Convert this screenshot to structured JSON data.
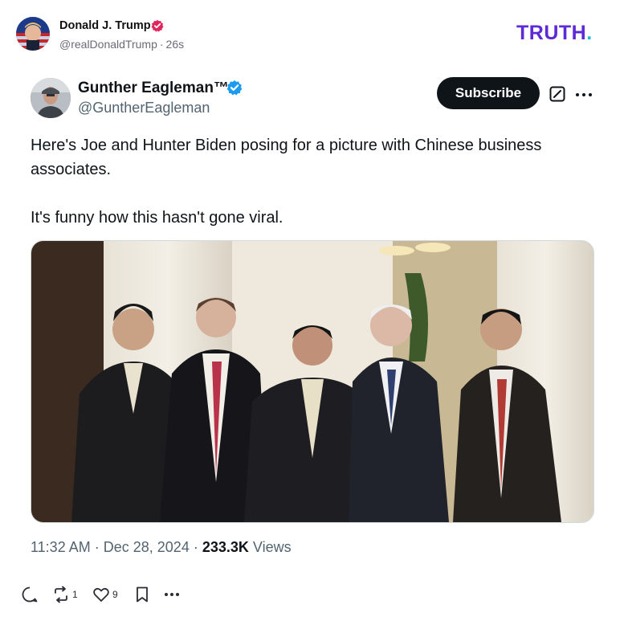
{
  "header": {
    "author_name": "Donald J. Trump",
    "author_handle": "@realDonaldTrump",
    "separator": "·",
    "time_ago": "26s",
    "logo_text": "TRUTH",
    "logo_dot": "."
  },
  "post": {
    "author_name": "Gunther Eagleman™",
    "author_handle": "@GuntherEagleman",
    "subscribe_label": "Subscribe",
    "paragraphs": [
      "Here's Joe and Hunter Biden posing for a picture with Chinese business associates.",
      "It's funny how this hasn't gone viral."
    ],
    "time": "11:32 AM",
    "date": "Dec 28, 2024",
    "views_count": "233.3K",
    "views_label": "Views",
    "sep": "·"
  },
  "actions": {
    "reply_count": "",
    "repost_count": "1",
    "like_count": "9"
  },
  "colors": {
    "truth_purple": "#5c2ad6",
    "truth_dot": "#1bbcd4",
    "x_verified_blue": "#1d9bf0",
    "ts_verified_red": "#e0245e",
    "text_primary": "#0f1419",
    "text_secondary": "#536471"
  },
  "icons": {
    "verified_ts": "verified-badge-icon",
    "verified_x": "verified-badge-icon",
    "grok": "grok-icon",
    "more": "more-icon",
    "reply": "reply-icon",
    "repost": "repost-icon",
    "like": "heart-icon",
    "bookmark": "bookmark-icon",
    "menu": "more-icon"
  }
}
